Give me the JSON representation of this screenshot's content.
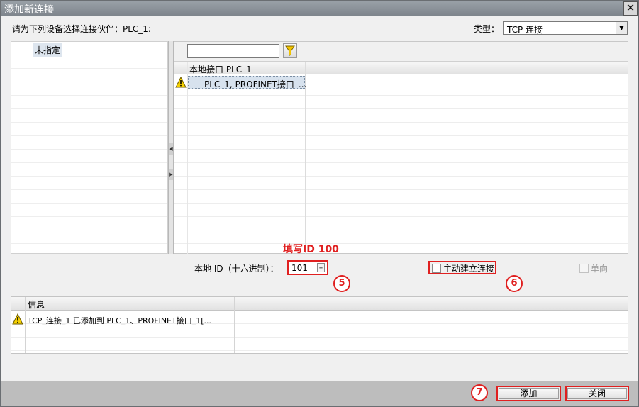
{
  "window": {
    "title": "添加新连接",
    "close_symbol": "✕"
  },
  "prompt": "请为下列设备选择连接伙伴：PLC_1:",
  "type_selector": {
    "label": "类型：",
    "value": "TCP 连接"
  },
  "left_panel": {
    "items": [
      "未指定"
    ]
  },
  "right_panel": {
    "filter_placeholder": "",
    "column_header": "本地接口 PLC_1",
    "rows": [
      {
        "interface": "PLC_1, PROFINET接口_..."
      }
    ]
  },
  "local_id": {
    "label": "本地 ID（十六进制）：",
    "value": "101"
  },
  "annotation": {
    "text": "填写ID 100"
  },
  "markers": {
    "m5": "5",
    "m6": "6",
    "m7": "7"
  },
  "active_connect": {
    "label": "主动建立连接",
    "checked": false
  },
  "one_way": {
    "label": "单向",
    "checked": false,
    "disabled": true
  },
  "info_panel": {
    "header": "信息",
    "messages": [
      "TCP_连接_1 已添加到 PLC_1、PROFINET接口_1[..."
    ]
  },
  "buttons": {
    "add": "添加",
    "close": "关闭"
  },
  "colors": {
    "annotation_red": "#e02020",
    "titlebar": "#8a9097",
    "selection": "#d7e2ee"
  },
  "icons": [
    "close-icon",
    "filter-icon",
    "warning-icon",
    "spinner-icon",
    "dropdown-arrow-icon"
  ]
}
